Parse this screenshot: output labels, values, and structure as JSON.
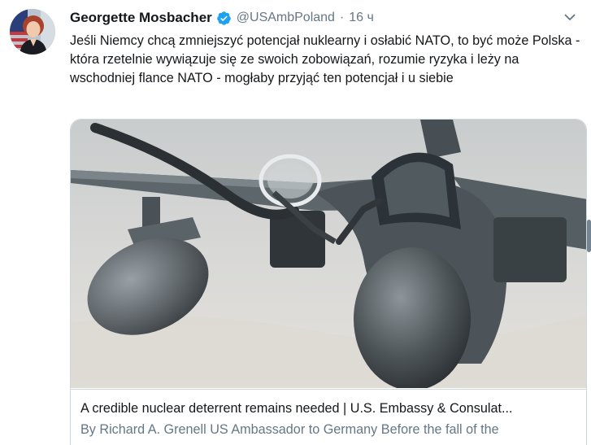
{
  "author": {
    "name": "Georgette Mosbacher",
    "handle": "@USAmbPoland",
    "separator": "·",
    "timestamp": "16 ч",
    "verified": true
  },
  "tweet": {
    "text": "Jeśli Niemcy chcą zmniejszyć potencjał nuklearny i osłabić NATO, to być może Polska - która rzetelnie wywiązuje się ze swoich zobowiązań, rozumie ryzyka i leży na wschodniej flance NATO - mogłaby przyjąć ten potencjał i u siebie"
  },
  "card": {
    "title": "A credible nuclear deterrent remains needed | U.S. Embassy & Consulat...",
    "description": "By Richard A. Grenell US Ambassador to Germany   Before the fall of the"
  },
  "colors": {
    "text_primary": "#14171a",
    "text_secondary": "#657786",
    "verified_blue": "#1da1f2",
    "border": "#ccd6dd"
  },
  "icons": {
    "verified": "verified-badge-icon",
    "menu": "chevron-down-icon"
  }
}
